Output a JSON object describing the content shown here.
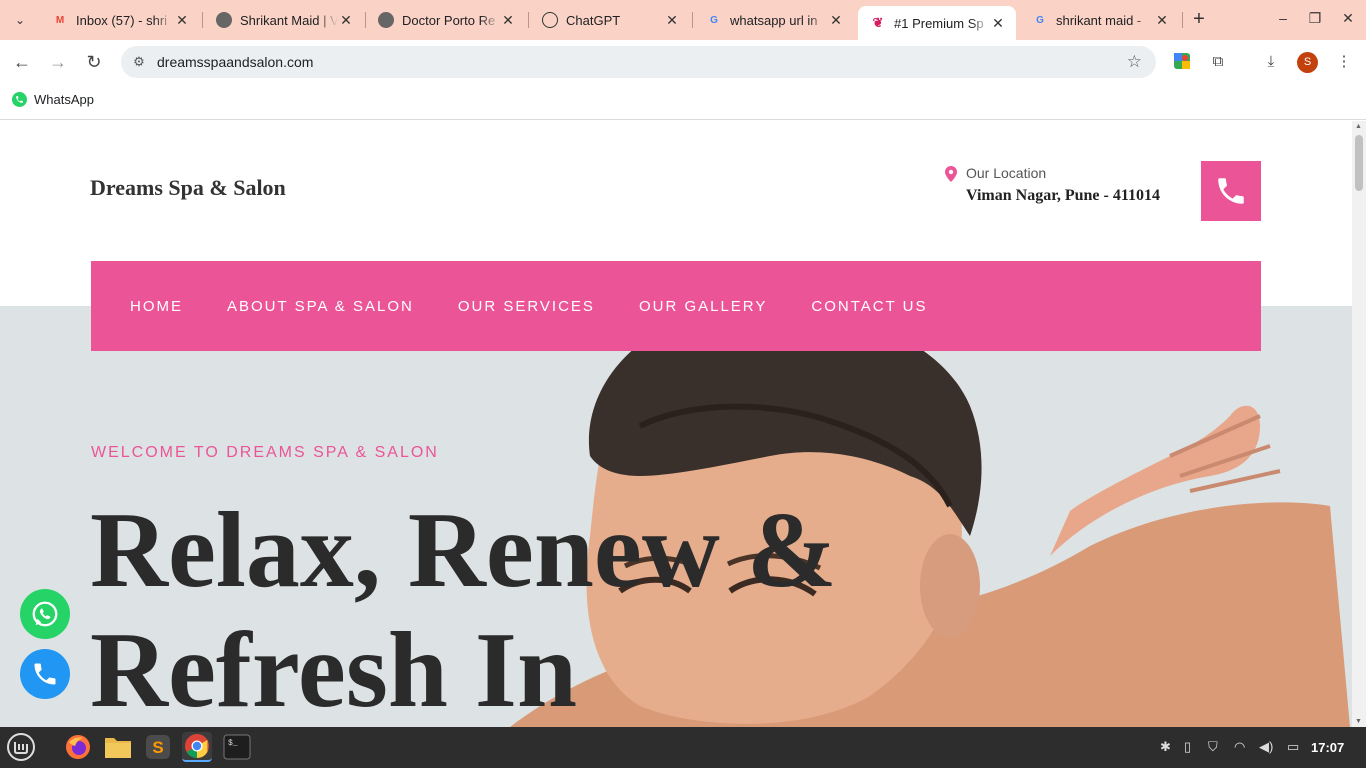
{
  "browser": {
    "tabs": [
      {
        "title": "Inbox (57) - shri",
        "favicon": "gmail-icon",
        "color": "#ea4335"
      },
      {
        "title": "Shrikant Maid | V",
        "favicon": "globe-icon",
        "color": "#555555"
      },
      {
        "title": "Doctor Porto Re",
        "favicon": "globe-icon",
        "color": "#555555"
      },
      {
        "title": "ChatGPT",
        "favicon": "chatgpt-icon",
        "color": "#333333"
      },
      {
        "title": "whatsapp url in",
        "favicon": "google-icon",
        "color": "#4285f4"
      },
      {
        "title": "#1 Premium Sp",
        "favicon": "spa-icon",
        "color": "#d81b60"
      },
      {
        "title": "shrikant maid - ",
        "favicon": "google-icon",
        "color": "#4285f4"
      }
    ],
    "active_tab": 5,
    "url": "dreamsspaandsalon.com",
    "bookmark": "WhatsApp",
    "profile_initial": "S"
  },
  "site": {
    "brand": "Dreams Spa & Salon",
    "location_label": "Our Location",
    "location_value": "Viman Nagar, Pune - 411014",
    "nav": [
      "HOME",
      "ABOUT SPA & SALON",
      "OUR SERVICES",
      "OUR GALLERY",
      "CONTACT US"
    ],
    "welcome": "WELCOME TO DREAMS SPA & SALON",
    "headline_1": "Relax, Renew &",
    "headline_2": "Refresh In",
    "accent_color": "#eb5598"
  },
  "taskbar": {
    "clock": "17:07",
    "apps": [
      "mint-menu-icon",
      "firefox-icon",
      "files-icon",
      "sublime-icon",
      "chrome-icon",
      "terminal-icon"
    ]
  }
}
